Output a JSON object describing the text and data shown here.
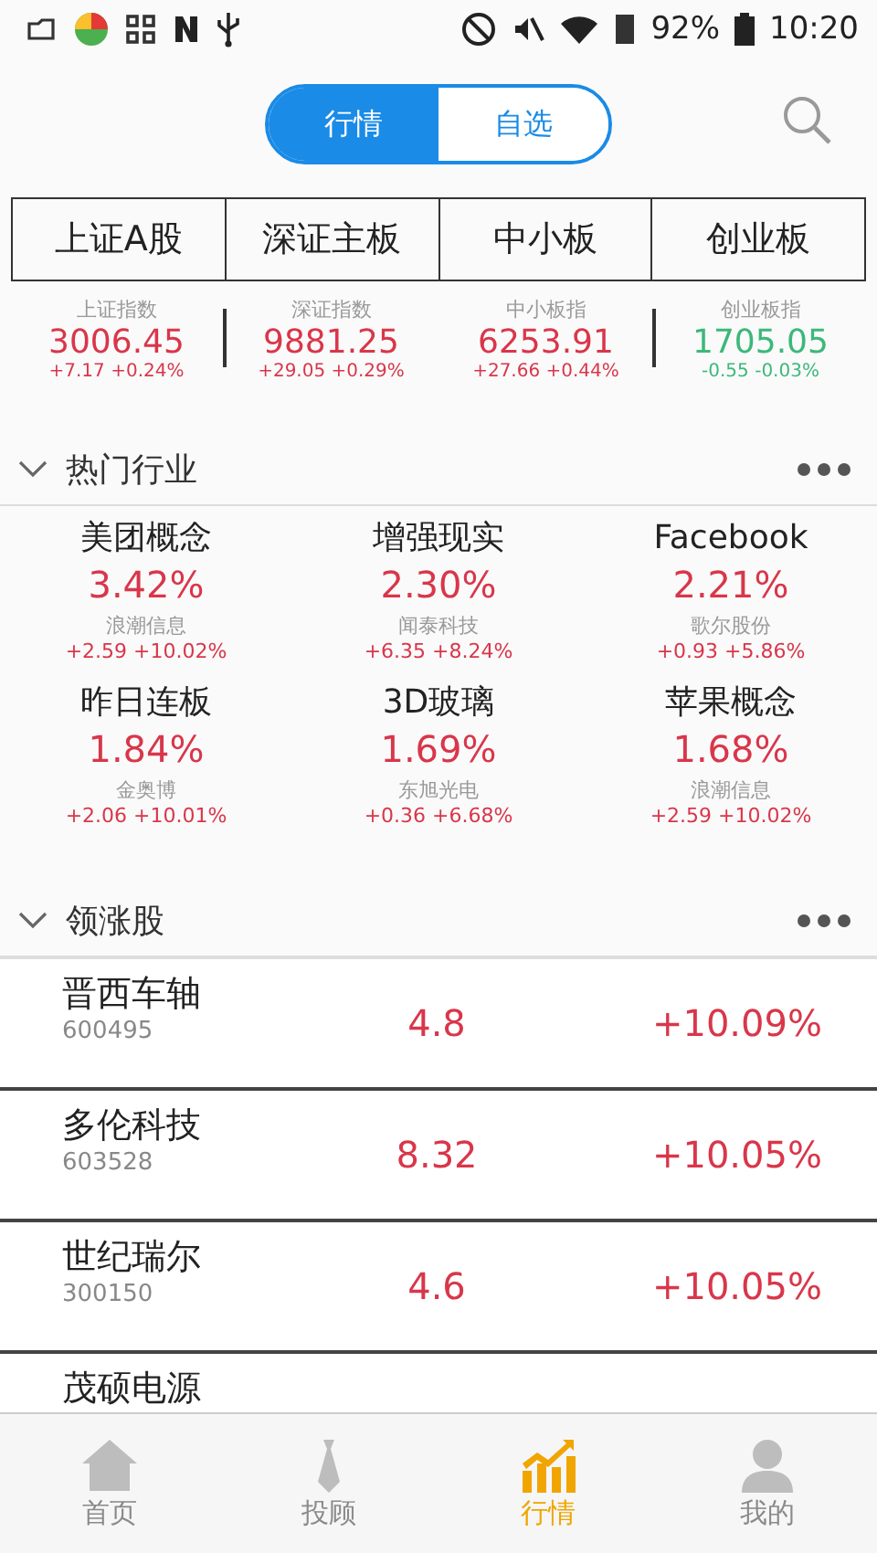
{
  "status_bar": {
    "battery": "92%",
    "time": "10:20"
  },
  "view_toggle": [
    {
      "label": "行情",
      "selected": true
    },
    {
      "label": "自选",
      "selected": false
    }
  ],
  "market_tabs": [
    {
      "label": "上证A股",
      "selected": false
    },
    {
      "label": "深证主板",
      "selected": false
    },
    {
      "label": "中小板",
      "selected": false
    },
    {
      "label": "创业板",
      "selected": false
    }
  ],
  "indices": [
    {
      "name": "上证指数",
      "value": "3006.45",
      "change": "+7.17 +0.24%",
      "color": "#d9364a"
    },
    {
      "name": "深证指数",
      "value": "9881.25",
      "change": "+29.05 +0.29%",
      "color": "#d9364a"
    },
    {
      "name": "中小板指",
      "value": "6253.91",
      "change": "+27.66 +0.44%",
      "color": "#d9364a"
    },
    {
      "name": "创业板指",
      "value": "1705.05",
      "change": "-0.55 -0.03%",
      "color": "#3cb87a"
    }
  ],
  "hot_sectors": {
    "title": "热门行业",
    "items": [
      {
        "name": "美团概念",
        "pct": "3.42%",
        "leader": "浪潮信息",
        "leader_change": "+2.59 +10.02%"
      },
      {
        "name": "增强现实",
        "pct": "2.30%",
        "leader": "闻泰科技",
        "leader_change": "+6.35 +8.24%"
      },
      {
        "name": "Facebook",
        "pct": "2.21%",
        "leader": "歌尔股份",
        "leader_change": "+0.93 +5.86%"
      },
      {
        "name": "昨日连板",
        "pct": "1.84%",
        "leader": "金奥博",
        "leader_change": "+2.06 +10.01%"
      },
      {
        "name": "3D玻璃",
        "pct": "1.69%",
        "leader": "东旭光电",
        "leader_change": "+0.36 +6.68%"
      },
      {
        "name": "苹果概念",
        "pct": "1.68%",
        "leader": "浪潮信息",
        "leader_change": "+2.59 +10.02%"
      }
    ]
  },
  "gainers": {
    "title": "领涨股",
    "rows": [
      {
        "name": "晋西车轴",
        "code": "600495",
        "price": "4.8",
        "change": "+10.09%"
      },
      {
        "name": "多伦科技",
        "code": "603528",
        "price": "8.32",
        "change": "+10.05%"
      },
      {
        "name": "世纪瑞尔",
        "code": "300150",
        "price": "4.6",
        "change": "+10.05%"
      },
      {
        "name": "茂硕电源"
      }
    ]
  },
  "bottom_nav": [
    {
      "label": "首页",
      "selected": false
    },
    {
      "label": "投顾",
      "selected": false
    },
    {
      "label": "行情",
      "selected": true
    },
    {
      "label": "我的",
      "selected": false
    }
  ]
}
